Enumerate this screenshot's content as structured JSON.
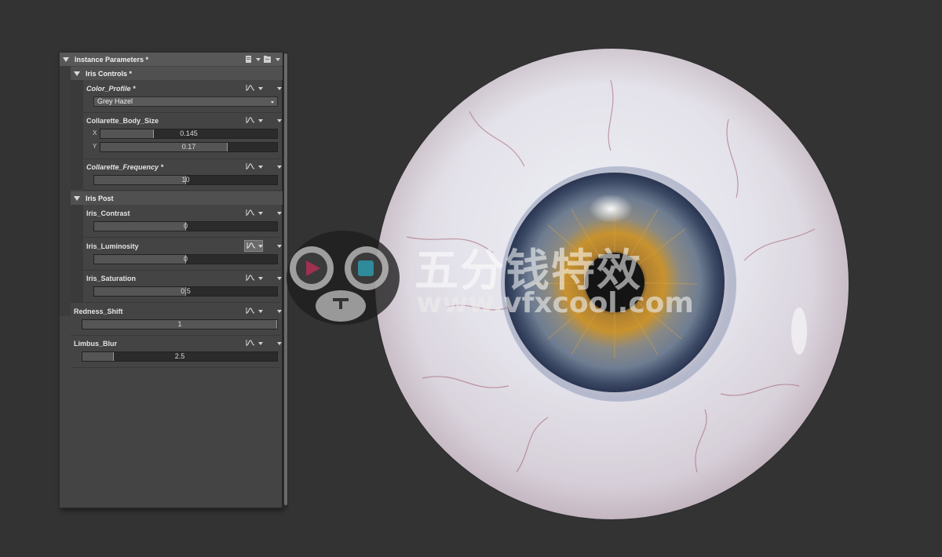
{
  "panel": {
    "title": "Instance Parameters *",
    "groups": {
      "iris_controls": {
        "label": "Iris Controls *"
      },
      "iris_post": {
        "label": "Iris Post"
      }
    },
    "params": {
      "color_profile": {
        "label": "Color_Profile *",
        "value": "Grey Hazel"
      },
      "collarette_body_size": {
        "label": "Collarette_Body_Size",
        "x_label": "X",
        "x_value": "0.145",
        "x_fill": 0.3,
        "y_label": "Y",
        "y_value": "0.17",
        "y_fill": 0.72
      },
      "collarette_frequency": {
        "label": "Collarette_Frequency *",
        "value": "10",
        "fill": 0.5
      },
      "iris_contrast": {
        "label": "Iris_Contrast",
        "value": "0",
        "fill": 0.5
      },
      "iris_luminosity": {
        "label": "Iris_Luminosity",
        "value": "0",
        "fill": 0.5
      },
      "iris_saturation": {
        "label": "Iris_Saturation",
        "value": "0.5",
        "fill": 0.5
      },
      "redness_shift": {
        "label": "Redness_Shift",
        "value": "1",
        "fill": 1.0
      },
      "limbus_blur": {
        "label": "Limbus_Blur",
        "value": "2.5",
        "fill": 0.16
      }
    }
  },
  "watermark": {
    "title": "五分钱特效",
    "url": "www.vfxcool.com"
  },
  "colors": {
    "background": "#333333",
    "panel": "#444444",
    "iris_outer": "#3c4a66",
    "iris_inner": "#c8922e"
  }
}
